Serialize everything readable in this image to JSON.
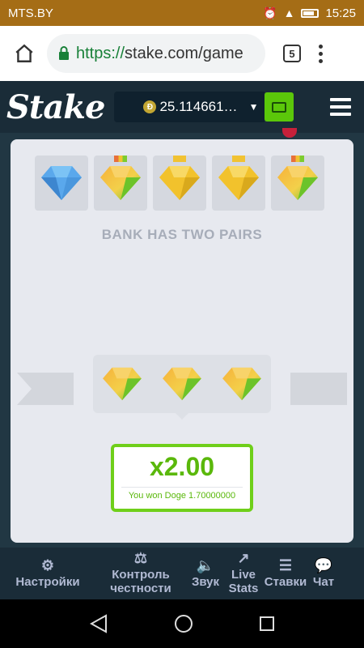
{
  "status_bar": {
    "carrier": "MTS.BY",
    "time": "15:25"
  },
  "browser": {
    "url_scheme": "https://",
    "url_host": "stake.com/game",
    "tab_count": "5"
  },
  "header": {
    "logo": "Stake",
    "currency_symbol": "Đ",
    "balance": "25.114661…"
  },
  "game": {
    "bank_gems": [
      "blue",
      "orange-multi",
      "gold",
      "gold",
      "orange-multi"
    ],
    "bank_status": "BANK HAS TWO PAIRS",
    "player_gems": [
      "orange-multi",
      "orange-multi",
      "orange-multi"
    ],
    "multiplier": "x2.00",
    "win_message": "You won Doge 1.70000000"
  },
  "controls": [
    {
      "label": "Настройки",
      "icon": "gear-icon"
    },
    {
      "label": "Контроль\nчестности",
      "icon": "scales-icon"
    },
    {
      "label": "Звук",
      "icon": "speaker-icon"
    },
    {
      "label": "Live\nStats",
      "icon": "trend-icon"
    },
    {
      "label": "Ставки",
      "icon": "list-icon"
    },
    {
      "label": "Чат",
      "icon": "chat-icon"
    }
  ],
  "colors": {
    "accent_green": "#5bc70a",
    "win_green": "#5ab80b",
    "header_bg": "#1a2c38",
    "status_bar": "#a56d16"
  }
}
